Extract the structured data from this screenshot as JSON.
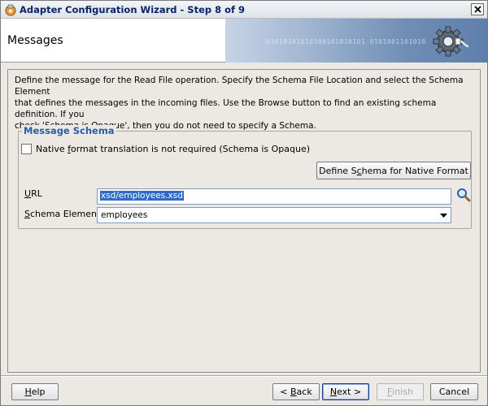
{
  "window": {
    "title": "Adapter Configuration Wizard - Step 8 of 9",
    "close_label": "x"
  },
  "banner": {
    "title": "Messages",
    "bits": "01010101010100101010101 0101001101010"
  },
  "description": {
    "line1": "Define the message for the Read File operation.  Specify the Schema File Location and select the Schema Element",
    "line2": "that defines the messages in the incoming files. Use the Browse button to find an existing schema definition. If you",
    "line3": "check 'Schema is Opaque', then you do not need to specify a Schema."
  },
  "message_schema": {
    "legend": "Message Schema",
    "opaque_checkbox": {
      "label_pre": "Native ",
      "label_mnemonic": "f",
      "label_post": "ormat translation is not required (Schema is Opaque)",
      "checked": false
    },
    "define_button": {
      "label_pre": "Define S",
      "label_mnemonic": "c",
      "label_post": "hema for Native Format"
    },
    "url": {
      "label_mnemonic": "U",
      "label_post": "RL",
      "value": "xsd/employees.xsd"
    },
    "schema_element": {
      "label_mnemonic": "S",
      "label_post": "chema Element",
      "selected": "employees"
    }
  },
  "footer": {
    "help": {
      "mnemonic": "H",
      "post": "elp"
    },
    "back": {
      "pre": "< ",
      "mnemonic": "B",
      "post": "ack"
    },
    "next": {
      "mnemonic": "N",
      "post": "ext >"
    },
    "finish": {
      "mnemonic": "F",
      "post": "inish",
      "enabled": false
    },
    "cancel": {
      "label": "Cancel"
    }
  },
  "colors": {
    "legend": "#2f5aa7",
    "selection": "#3169c6",
    "banner_art": "#6f8db4"
  }
}
